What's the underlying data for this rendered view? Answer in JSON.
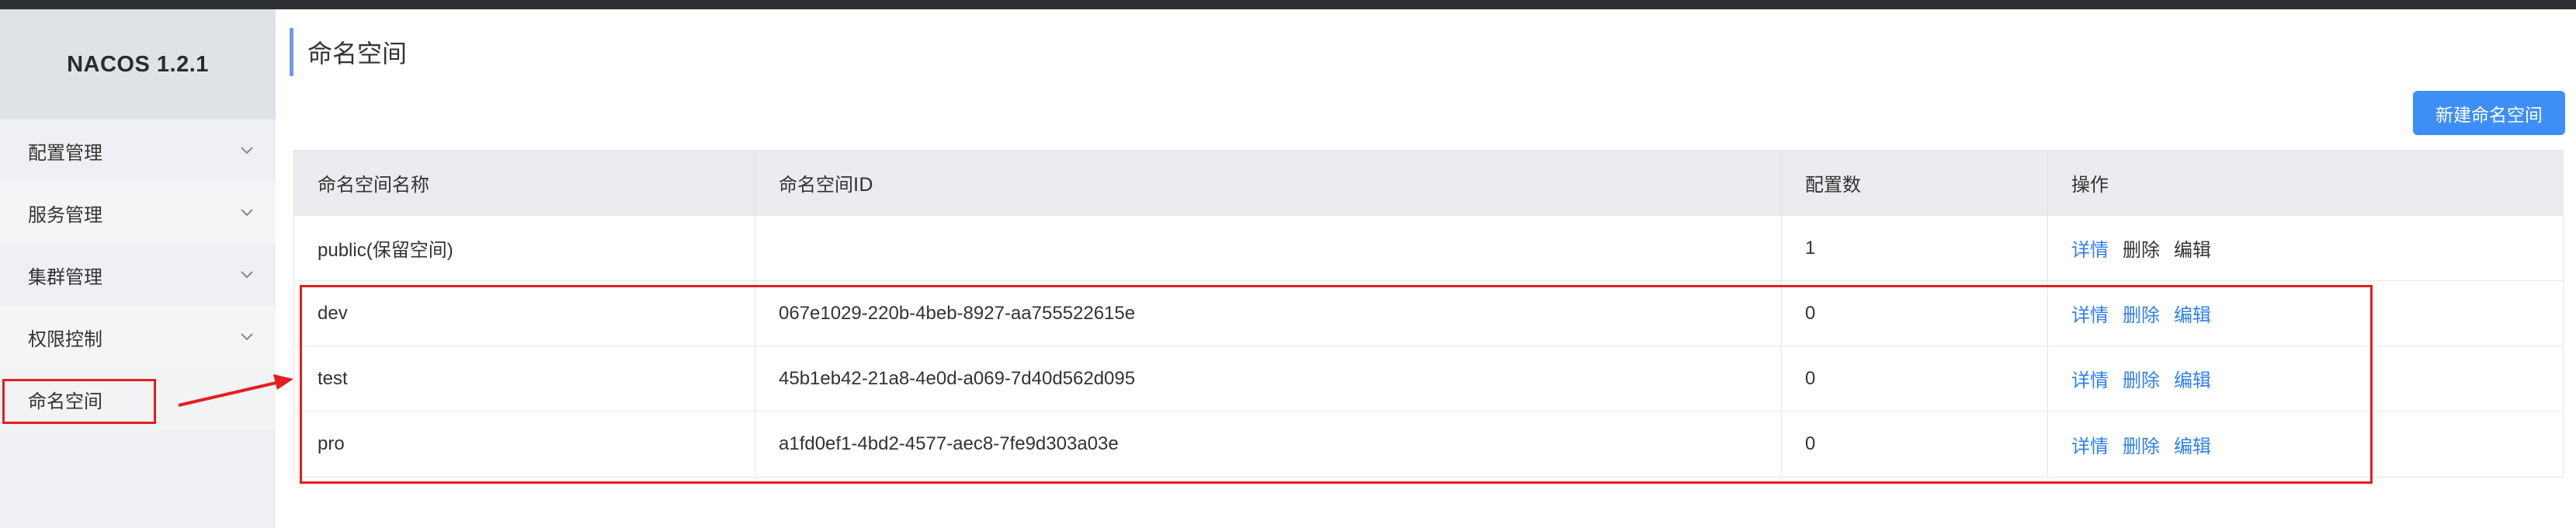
{
  "app": {
    "brand": "NACOS 1.2.1"
  },
  "sidebar": {
    "items": [
      {
        "label": "配置管理",
        "expandable": true
      },
      {
        "label": "服务管理",
        "expandable": true
      },
      {
        "label": "集群管理",
        "expandable": true
      },
      {
        "label": "权限控制",
        "expandable": true
      },
      {
        "label": "命名空间",
        "expandable": false,
        "active": true
      }
    ]
  },
  "page": {
    "title": "命名空间",
    "new_button": "新建命名空间"
  },
  "table": {
    "columns": [
      "命名空间名称",
      "命名空间ID",
      "配置数",
      "操作"
    ],
    "rows": [
      {
        "name": "public(保留空间)",
        "id": "",
        "count": "1",
        "ops": [
          "详情",
          "删除",
          "编辑"
        ],
        "reserved": true
      },
      {
        "name": "dev",
        "id": "067e1029-220b-4beb-8927-aa755522615e",
        "count": "0",
        "ops": [
          "详情",
          "删除",
          "编辑"
        ]
      },
      {
        "name": "test",
        "id": "45b1eb42-21a8-4e0d-a069-7d40d562d095",
        "count": "0",
        "ops": [
          "详情",
          "删除",
          "编辑"
        ]
      },
      {
        "name": "pro",
        "id": "a1fd0ef1-4bd2-4577-aec8-7fe9d303a03e",
        "count": "0",
        "ops": [
          "详情",
          "删除",
          "编辑"
        ]
      }
    ]
  },
  "colors": {
    "accent": "#3e8ef7",
    "link": "#2f7ff0",
    "annotation": "#e41e1e"
  }
}
